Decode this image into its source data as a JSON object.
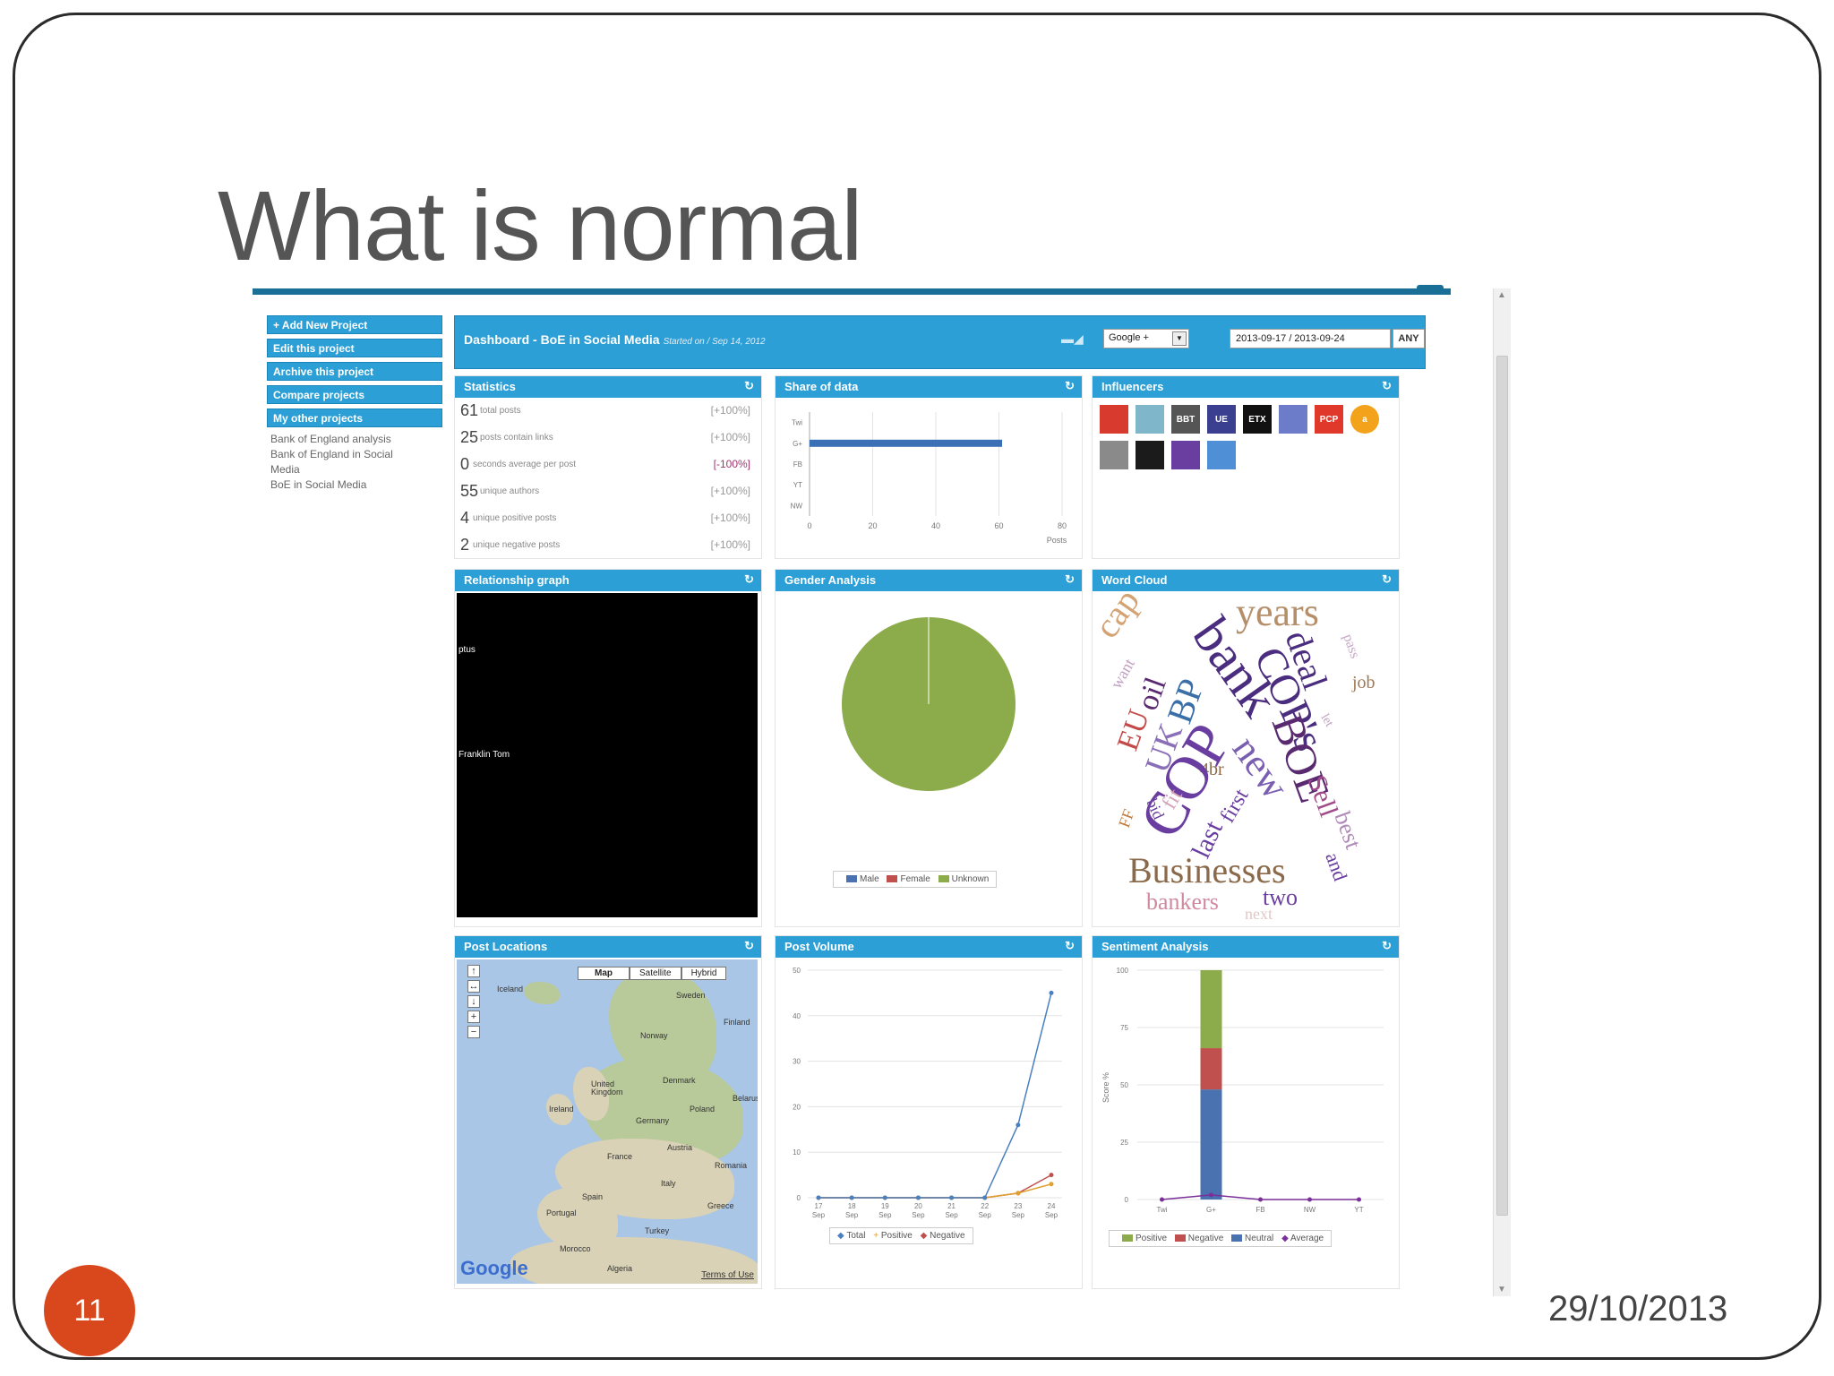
{
  "slide": {
    "title": "What is normal",
    "number": "11",
    "date": "29/10/2013"
  },
  "sidebar": {
    "buttons": [
      "+ Add New Project",
      "Edit this project",
      "Archive this project",
      "Compare projects",
      "My other projects"
    ],
    "projects": [
      "Bank of England analysis",
      "Bank of England in Social Media",
      "BoE in Social Media"
    ]
  },
  "header": {
    "title": "Dashboard - BoE in Social Media",
    "subtitle": "Started on / Sep 14, 2012",
    "network": "Google +",
    "date_range": "2013-09-17 / 2013-09-24",
    "any_button": "ANY"
  },
  "panels": {
    "statistics": "Statistics",
    "share": "Share of data",
    "influencers": "Influencers",
    "relationship": "Relationship graph",
    "gender": "Gender Analysis",
    "wordcloud": "Word Cloud",
    "locations": "Post Locations",
    "volume": "Post Volume",
    "sentiment": "Sentiment Analysis"
  },
  "statistics": [
    {
      "value": "61",
      "label": "total posts",
      "change": "[+100%]"
    },
    {
      "value": "25",
      "label": "posts contain links",
      "change": "[+100%]"
    },
    {
      "value": "0",
      "label": "seconds average per post",
      "change": "[-100%]"
    },
    {
      "value": "55",
      "label": "unique authors",
      "change": "[+100%]"
    },
    {
      "value": "4",
      "label": "unique positive posts",
      "change": "[+100%]"
    },
    {
      "value": "2",
      "label": "unique negative posts",
      "change": "[+100%]"
    }
  ],
  "influencers": [
    {
      "label": "",
      "color": "#d83a2e"
    },
    {
      "label": "",
      "color": "#7fb6c9"
    },
    {
      "label": "BBT",
      "color": "#555555"
    },
    {
      "label": "UE",
      "color": "#3a3f8f"
    },
    {
      "label": "ETX",
      "color": "#111111"
    },
    {
      "label": "",
      "color": "#6d7cc8"
    },
    {
      "label": "PCP",
      "color": "#e0382b"
    },
    {
      "label": "a",
      "color": "#f2a31b"
    },
    {
      "label": "",
      "color": "#8a8a8a"
    },
    {
      "label": "",
      "color": "#1b1b1b"
    },
    {
      "label": "",
      "color": "#6a3da0"
    },
    {
      "label": "",
      "color": "#4f8fd6"
    }
  ],
  "relationship_labels": [
    "ptus",
    "Franklin Tom"
  ],
  "map": {
    "buttons": [
      "Map",
      "Satellite",
      "Hybrid"
    ],
    "places": [
      "Iceland",
      "Sweden",
      "Finland",
      "Norway",
      "Denmark",
      "United Kingdom",
      "Ireland",
      "Poland",
      "Belarus",
      "Germany",
      "France",
      "Austria",
      "Romania",
      "Spain",
      "Italy",
      "Greece",
      "Portugal",
      "Turkey",
      "Morocco",
      "Algeria"
    ],
    "logo": "Google",
    "terms": "Terms of Use"
  },
  "wordcloud": {
    "words": [
      "cap",
      "bank",
      "years",
      "deal",
      "COP's",
      "pass",
      "job",
      "oil",
      "EU",
      "UK",
      "BP",
      "BOE",
      "Sell",
      "4br",
      "new",
      "COP",
      "first",
      "last",
      "fit",
      "bid",
      "FF",
      "best",
      "and",
      "Businesses",
      "bankers",
      "two",
      "next",
      "let",
      "want"
    ]
  },
  "chart_data": [
    {
      "type": "bar",
      "orientation": "horizontal",
      "title": "Share of data",
      "categories": [
        "Twi",
        "G+",
        "FB",
        "YT",
        "NW"
      ],
      "values": [
        0,
        61,
        0,
        0,
        0
      ],
      "xlabel": "Posts",
      "xlim": [
        0,
        80
      ],
      "xticks": [
        "0",
        "20",
        "40",
        "60",
        "80"
      ]
    },
    {
      "type": "pie",
      "title": "Gender Analysis",
      "labels": [
        "Male",
        "Female",
        "Unknown"
      ],
      "values": [
        0,
        0,
        100
      ],
      "colors": [
        "#4a72b0",
        "#c0504d",
        "#8cab4a"
      ]
    },
    {
      "type": "line",
      "title": "Post Volume",
      "x": [
        "17 Sep",
        "18 Sep",
        "19 Sep",
        "20 Sep",
        "21 Sep",
        "22 Sep",
        "23 Sep",
        "24 Sep"
      ],
      "ylim": [
        0,
        50
      ],
      "yticks": [
        "0",
        "10",
        "20",
        "30",
        "40",
        "50"
      ],
      "series": [
        {
          "name": "Total",
          "values": [
            0,
            0,
            0,
            0,
            0,
            0,
            16,
            45
          ],
          "color": "#4a7fc0"
        },
        {
          "name": "Positive",
          "values": [
            0,
            0,
            0,
            0,
            0,
            0,
            1,
            3
          ],
          "color": "#e0a030"
        },
        {
          "name": "Negative",
          "values": [
            0,
            0,
            0,
            0,
            0,
            0,
            1,
            5
          ],
          "color": "#c0504d"
        }
      ]
    },
    {
      "type": "bar",
      "stacked": true,
      "title": "Sentiment Analysis",
      "categories": [
        "Twi",
        "G+",
        "FB",
        "NW",
        "YT"
      ],
      "ylabel": "Score %",
      "ylim": [
        0,
        100
      ],
      "yticks": [
        "0",
        "25",
        "50",
        "75",
        "100"
      ],
      "series": [
        {
          "name": "Neutral",
          "values": [
            0,
            48,
            0,
            0,
            0
          ],
          "color": "#4a72b0"
        },
        {
          "name": "Negative",
          "values": [
            0,
            18,
            0,
            0,
            0
          ],
          "color": "#c0504d"
        },
        {
          "name": "Positive",
          "values": [
            0,
            34,
            0,
            0,
            0
          ],
          "color": "#8cab4a"
        },
        {
          "name": "Average",
          "values": [
            0,
            2,
            0,
            0,
            0
          ],
          "color": "#7a2f9a",
          "kind": "line"
        }
      ],
      "legend": [
        "Positive",
        "Negative",
        "Neutral",
        "Average"
      ]
    }
  ]
}
